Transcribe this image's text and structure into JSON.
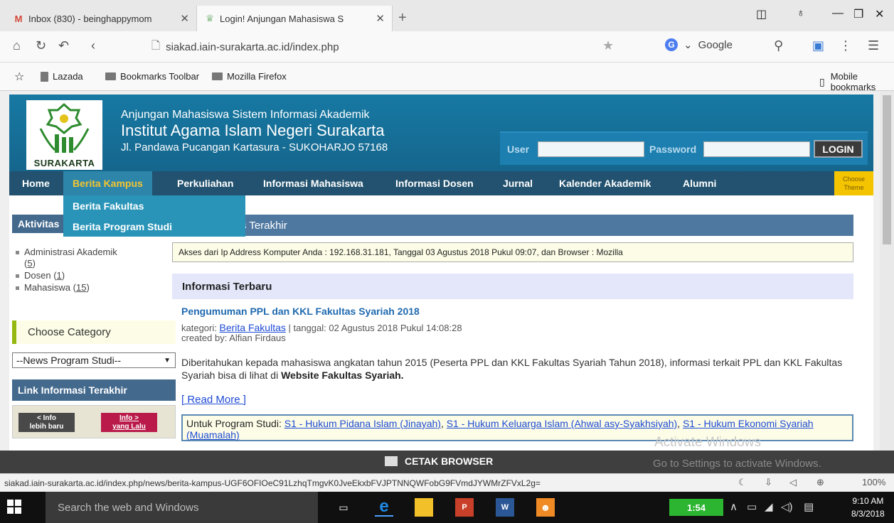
{
  "browser": {
    "tabs": [
      {
        "label": "Inbox (830) - beinghappymom",
        "icon": "gmail-icon",
        "active": false
      },
      {
        "label": "Login! Anjungan Mahasiswa S",
        "icon": "iain-favicon",
        "active": true
      }
    ],
    "url": "siakad.iain-surakarta.ac.id/index.php",
    "search_engine": "Google",
    "bookmarks": [
      "Lazada",
      "Bookmarks Toolbar",
      "Mozilla Firefox"
    ],
    "mobile_bookmarks": "Mobile bookmarks"
  },
  "header": {
    "logo_text": "SURAKARTA",
    "line1": "Anjungan Mahasiswa Sistem Informasi Akademik",
    "line2": "Institut Agama Islam Negeri Surakarta",
    "line3": "Jl. Pandawa Pucangan Kartasura - SUKOHARJO 57168",
    "user_label": "User",
    "password_label": "Password",
    "login_label": "LOGIN"
  },
  "menu": {
    "items": [
      "Home",
      "Berita Kampus",
      "Perkuliahan",
      "Informasi Mahasiswa",
      "Informasi Dosen",
      "Jurnal",
      "Kalender Akademik",
      "Alumni"
    ],
    "theme_line1": "Choose",
    "theme_line2": "Theme",
    "dropdown": [
      "Berita Fakultas",
      "Berita Program Studi"
    ]
  },
  "sidebar": {
    "activity_title": "Aktivitas",
    "activity_items": [
      {
        "label": "Administrasi Akademik",
        "count": "5"
      },
      {
        "label": "Dosen",
        "count": "1"
      },
      {
        "label": "Mahasiswa",
        "count": "15"
      }
    ],
    "category_title": "Choose Category",
    "category_select": "--News Program Studi--",
    "link_info_title": "Link Informasi Terakhir",
    "btn_newer": "< Info lebih baru",
    "btn_newer_l1": "< Info",
    "btn_newer_l2": "lebih baru",
    "btn_older_l1": "Info >",
    "btn_older_l2": "yang Lalu"
  },
  "main": {
    "section_title": "s Terakhir",
    "access_text": "Akses dari Ip Address Komputer Anda : 192.168.31.181, Tanggal 03 Agustus 2018 Pukul 09:07, dan Browser : Mozilla",
    "info_title": "Informasi Terbaru",
    "news_title": "Pengumuman PPL dan KKL Fakultas Syariah 2018",
    "category_prefix": "kategori:",
    "category_link": "Berita Fakultas",
    "date_text": "| tanggal: 02 Agustus 2018 Pukul 14:08:28",
    "created_by": "created by: Alfian Firdaus",
    "body": "Diberitahukan kepada mahasiswa angkatan tahun 2015 (Peserta PPL dan KKL Fakultas Syariah Tahun 2018), informasi terkait PPL dan KKL Fakultas Syariah bisa di lihat di",
    "body_bold": "Website Fakultas Syariah.",
    "read_more": "[ Read More ]",
    "prodi_prefix": "Untuk Program Studi:",
    "prodi_links": [
      "S1 - Hukum Pidana Islam (Jinayah)",
      "S1 - Hukum Keluarga Islam (Ahwal asy-Syakhsiyah)",
      "S1 - Hukum Ekonomi Syariah (Muamalah)"
    ]
  },
  "footer": {
    "cetak": "CETAK BROWSER",
    "watermark1": "Activate Windows",
    "watermark2": "Go to Settings to activate Windows.",
    "status_url": "siakad.iain-surakarta.ac.id/index.php/news/berita-kampus-UGF6OFIOeC91LzhqTmgvK0JveEkxbFVJPTNNQWFobG9FVmdJYWMrZFVxL2g=",
    "zoom": "100%"
  },
  "taskbar": {
    "search_placeholder": "Search the web and Windows",
    "battery_time": "1:54",
    "time": "9:10 AM",
    "date": "8/3/2018"
  }
}
